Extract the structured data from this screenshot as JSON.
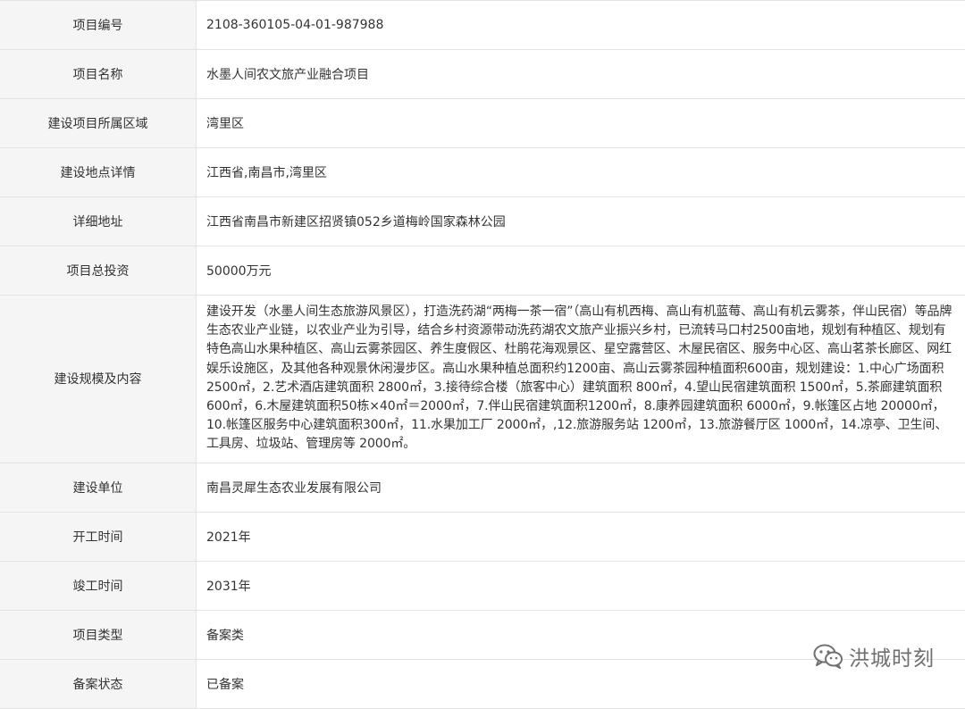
{
  "rows": [
    {
      "label": "项目编号",
      "value": "2108-360105-04-01-987988"
    },
    {
      "label": "项目名称",
      "value": "水墨人间农文旅产业融合项目"
    },
    {
      "label": "建设项目所属区域",
      "value": "湾里区"
    },
    {
      "label": "建设地点详情",
      "value": "江西省,南昌市,湾里区"
    },
    {
      "label": "详细地址",
      "value": "江西省南昌市新建区招贤镇052乡道梅岭国家森林公园"
    },
    {
      "label": "项目总投资",
      "value": "50000万元"
    },
    {
      "label": "建设规模及内容",
      "value": "建设开发（水墨人间生态旅游风景区），打造洗药湖“两梅一茶一宿”（高山有机西梅、高山有机蓝莓、高山有机云雾茶，伴山民宿）等品牌生态农业产业链，以农业产业为引导，结合乡村资源带动洗药湖农文旅产业振兴乡村，已流转马口村2500亩地，规划有种植区、规划有特色高山水果种植区、高山云雾茶园区、养生度假区、杜鹃花海观景区、星空露营区、木屋民宿区、服务中心区、高山茗茶长廊区、网红娱乐设施区，及其他各种观景休闲漫步区。高山水果种植总面积约1200亩、高山云雾茶园种植面积600亩，规划建设：1.中心广场面积 2500㎡，2.艺术酒店建筑面积 2800㎡，3.接待综合楼（旅客中心）建筑面积 800㎡，4.望山民宿建筑面积 1500㎡，5.茶廊建筑面积 600㎡，6.木屋建筑面积50栋×40㎡＝2000㎡，7.伴山民宿建筑面积1200㎡，8.康养园建筑面积 6000㎡，9.帐篷区占地 20000㎡，10.帐篷区服务中心建筑面积300㎡，11.水果加工厂 2000㎡，,12.旅游服务站 1200㎡，13.旅游餐厅区 1000㎡，14.凉亭、卫生间、工具房、垃圾站、管理房等 2000㎡。"
    },
    {
      "label": "建设单位",
      "value": "南昌灵犀生态农业发展有限公司"
    },
    {
      "label": "开工时间",
      "value": "2021年"
    },
    {
      "label": "竣工时间",
      "value": "2031年"
    },
    {
      "label": "项目类型",
      "value": "备案类"
    },
    {
      "label": "备案状态",
      "value": "已备案"
    }
  ],
  "watermark": {
    "text": "洪城时刻",
    "icon": "wechat-icon"
  }
}
